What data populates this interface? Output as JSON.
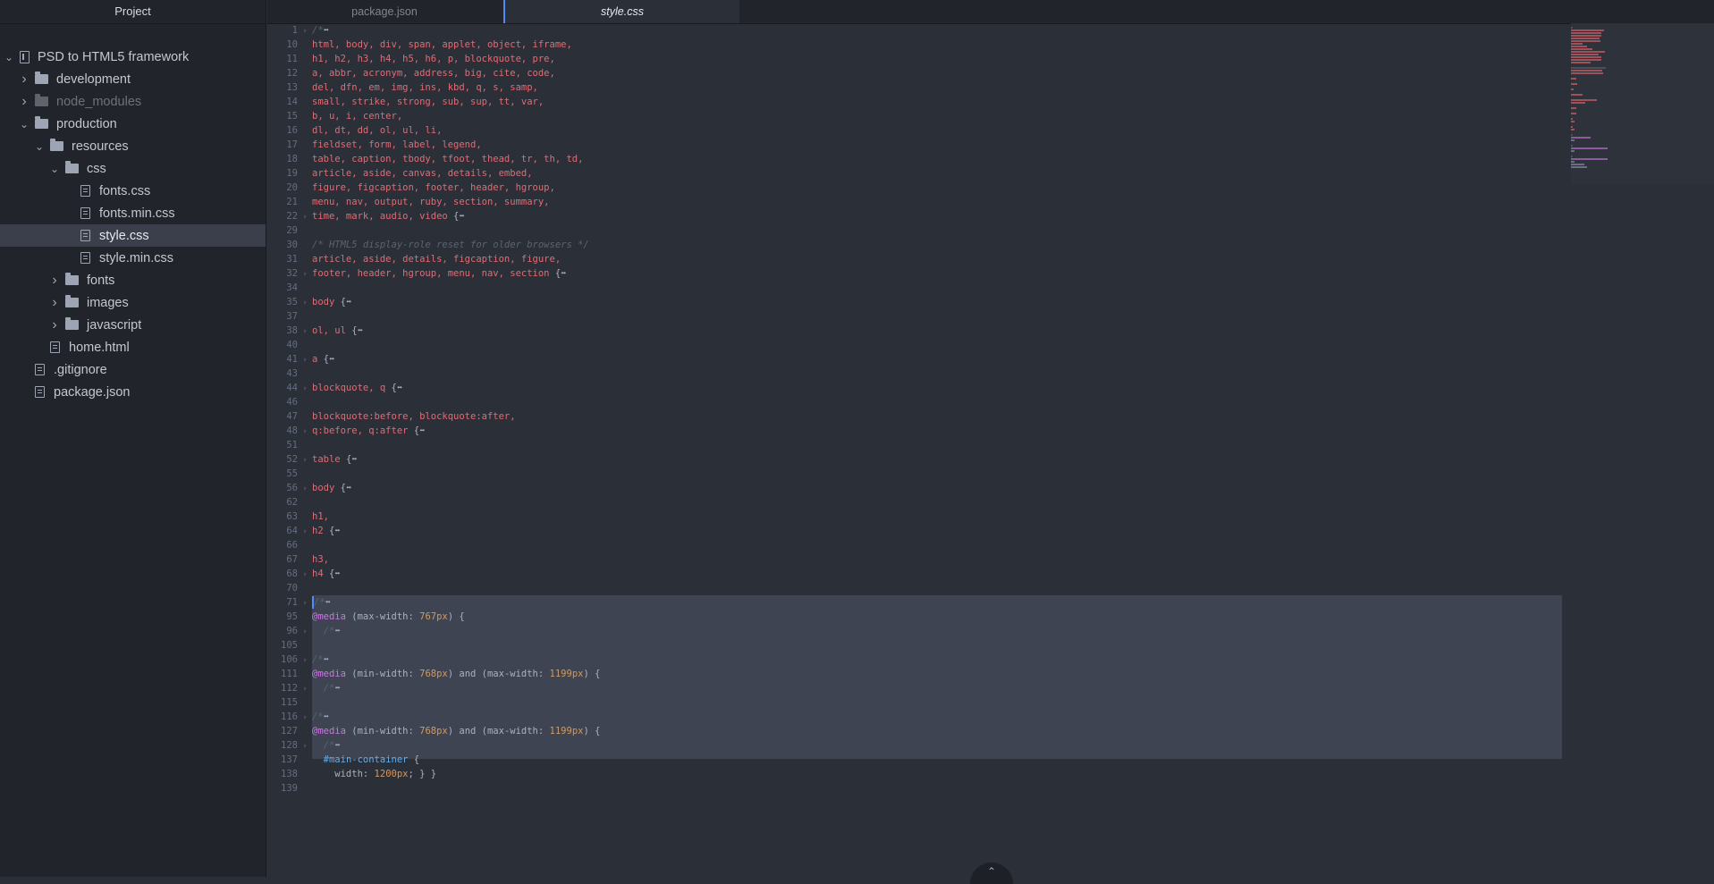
{
  "sidebar": {
    "title": "Project",
    "tree": [
      {
        "label": "PSD to HTML5 framework",
        "type": "repo",
        "depth": 0,
        "expanded": true
      },
      {
        "label": "development",
        "type": "folder",
        "depth": 1,
        "expanded": false
      },
      {
        "label": "node_modules",
        "type": "folder",
        "depth": 1,
        "expanded": false,
        "dim": true
      },
      {
        "label": "production",
        "type": "folder",
        "depth": 1,
        "expanded": true
      },
      {
        "label": "resources",
        "type": "folder",
        "depth": 2,
        "expanded": true
      },
      {
        "label": "css",
        "type": "folder",
        "depth": 3,
        "expanded": true
      },
      {
        "label": "fonts.css",
        "type": "file",
        "depth": 4
      },
      {
        "label": "fonts.min.css",
        "type": "file",
        "depth": 4
      },
      {
        "label": "style.css",
        "type": "file",
        "depth": 4,
        "selected": true
      },
      {
        "label": "style.min.css",
        "type": "file",
        "depth": 4
      },
      {
        "label": "fonts",
        "type": "folder",
        "depth": 3,
        "expanded": false
      },
      {
        "label": "images",
        "type": "folder",
        "depth": 3,
        "expanded": false
      },
      {
        "label": "javascript",
        "type": "folder",
        "depth": 3,
        "expanded": false
      },
      {
        "label": "home.html",
        "type": "file",
        "depth": 2
      },
      {
        "label": ".gitignore",
        "type": "file",
        "depth": 1
      },
      {
        "label": "package.json",
        "type": "file",
        "depth": 1
      }
    ]
  },
  "tabs": [
    {
      "label": "package.json",
      "active": false
    },
    {
      "label": "style.css",
      "active": true
    }
  ],
  "colors": {
    "selector": "#e06c75",
    "comment": "#5c6370",
    "keyword": "#c678dd",
    "number": "#d19a66",
    "id": "#61afef",
    "selection": "#3e4451",
    "accent": "#568af2"
  },
  "code": [
    {
      "n": "1",
      "fold": true,
      "parts": [
        [
          "cmt",
          "/*"
        ],
        [
          "badge",
          "⬌"
        ]
      ]
    },
    {
      "n": "10",
      "parts": [
        [
          "sel",
          "html, body, div, span, applet, object, iframe,"
        ]
      ]
    },
    {
      "n": "11",
      "parts": [
        [
          "sel",
          "h1, h2, h3, h4, h5, h6, p, blockquote, pre,"
        ]
      ]
    },
    {
      "n": "12",
      "parts": [
        [
          "sel",
          "a, abbr, acronym, address, big, cite, code,"
        ]
      ]
    },
    {
      "n": "13",
      "parts": [
        [
          "sel",
          "del, dfn, em, img, ins, kbd, q, s, samp,"
        ]
      ]
    },
    {
      "n": "14",
      "parts": [
        [
          "sel",
          "small, strike, strong, sub, sup, tt, var,"
        ]
      ]
    },
    {
      "n": "15",
      "parts": [
        [
          "sel",
          "b, u, i, center,"
        ]
      ]
    },
    {
      "n": "16",
      "parts": [
        [
          "sel",
          "dl, dt, dd, ol, ul, li,"
        ]
      ]
    },
    {
      "n": "17",
      "parts": [
        [
          "sel",
          "fieldset, form, label, legend,"
        ]
      ]
    },
    {
      "n": "18",
      "parts": [
        [
          "sel",
          "table, caption, tbody, tfoot, thead, tr, th, td,"
        ]
      ]
    },
    {
      "n": "19",
      "parts": [
        [
          "sel",
          "article, aside, canvas, details, embed,"
        ]
      ]
    },
    {
      "n": "20",
      "parts": [
        [
          "sel",
          "figure, figcaption, footer, header, hgroup,"
        ]
      ]
    },
    {
      "n": "21",
      "parts": [
        [
          "sel",
          "menu, nav, output, ruby, section, summary,"
        ]
      ]
    },
    {
      "n": "22",
      "fold": true,
      "parts": [
        [
          "sel",
          "time, mark, audio, video "
        ],
        [
          "txt",
          "{"
        ],
        [
          "badge",
          "⬌"
        ]
      ]
    },
    {
      "n": "29",
      "parts": []
    },
    {
      "n": "30",
      "parts": [
        [
          "cmt",
          "/* HTML5 display-role reset for older browsers */"
        ]
      ]
    },
    {
      "n": "31",
      "parts": [
        [
          "sel",
          "article, aside, details, figcaption, figure,"
        ]
      ]
    },
    {
      "n": "32",
      "fold": true,
      "parts": [
        [
          "sel",
          "footer, header, hgroup, menu, nav, section "
        ],
        [
          "txt",
          "{"
        ],
        [
          "badge",
          "⬌"
        ]
      ]
    },
    {
      "n": "34",
      "parts": []
    },
    {
      "n": "35",
      "fold": true,
      "parts": [
        [
          "sel",
          "body "
        ],
        [
          "txt",
          "{"
        ],
        [
          "badge",
          "⬌"
        ]
      ]
    },
    {
      "n": "37",
      "parts": []
    },
    {
      "n": "38",
      "fold": true,
      "parts": [
        [
          "sel",
          "ol, ul "
        ],
        [
          "txt",
          "{"
        ],
        [
          "badge",
          "⬌"
        ]
      ]
    },
    {
      "n": "40",
      "parts": []
    },
    {
      "n": "41",
      "fold": true,
      "parts": [
        [
          "sel",
          "a "
        ],
        [
          "txt",
          "{"
        ],
        [
          "badge",
          "⬌"
        ]
      ]
    },
    {
      "n": "43",
      "parts": []
    },
    {
      "n": "44",
      "fold": true,
      "parts": [
        [
          "sel",
          "blockquote, q "
        ],
        [
          "txt",
          "{"
        ],
        [
          "badge",
          "⬌"
        ]
      ]
    },
    {
      "n": "46",
      "parts": []
    },
    {
      "n": "47",
      "parts": [
        [
          "sel",
          "blockquote:before, blockquote:after,"
        ]
      ]
    },
    {
      "n": "48",
      "fold": true,
      "parts": [
        [
          "sel",
          "q:before, q:after "
        ],
        [
          "txt",
          "{"
        ],
        [
          "badge",
          "⬌"
        ]
      ]
    },
    {
      "n": "51",
      "parts": []
    },
    {
      "n": "52",
      "fold": true,
      "parts": [
        [
          "sel",
          "table "
        ],
        [
          "txt",
          "{"
        ],
        [
          "badge",
          "⬌"
        ]
      ]
    },
    {
      "n": "55",
      "parts": []
    },
    {
      "n": "56",
      "fold": true,
      "parts": [
        [
          "sel",
          "body "
        ],
        [
          "txt",
          "{"
        ],
        [
          "badge",
          "⬌"
        ]
      ]
    },
    {
      "n": "62",
      "parts": []
    },
    {
      "n": "63",
      "parts": [
        [
          "sel",
          "h1,"
        ]
      ]
    },
    {
      "n": "64",
      "fold": true,
      "parts": [
        [
          "sel",
          "h2 "
        ],
        [
          "txt",
          "{"
        ],
        [
          "badge",
          "⬌"
        ]
      ]
    },
    {
      "n": "66",
      "parts": []
    },
    {
      "n": "67",
      "parts": [
        [
          "sel",
          "h3,"
        ]
      ]
    },
    {
      "n": "68",
      "fold": true,
      "parts": [
        [
          "sel",
          "h4 "
        ],
        [
          "txt",
          "{"
        ],
        [
          "badge",
          "⬌"
        ]
      ]
    },
    {
      "n": "70",
      "parts": []
    },
    {
      "n": "71",
      "fold": true,
      "cursor": true,
      "parts": [
        [
          "cmt",
          "/*"
        ],
        [
          "badge",
          "⬌"
        ]
      ]
    },
    {
      "n": "95",
      "parts": [
        [
          "kw",
          "@media"
        ],
        [
          "txt",
          " (max-width: "
        ],
        [
          "num",
          "767px"
        ],
        [
          "txt",
          ") {"
        ]
      ]
    },
    {
      "n": "96",
      "fold": true,
      "parts": [
        [
          "txt",
          "  "
        ],
        [
          "cmt",
          "/*"
        ],
        [
          "badge",
          "⬌"
        ]
      ]
    },
    {
      "n": "105",
      "parts": []
    },
    {
      "n": "106",
      "fold": true,
      "parts": [
        [
          "cmt",
          "/*"
        ],
        [
          "badge",
          "⬌"
        ]
      ]
    },
    {
      "n": "111",
      "parts": [
        [
          "kw",
          "@media"
        ],
        [
          "txt",
          " (min-width: "
        ],
        [
          "num",
          "768px"
        ],
        [
          "txt",
          ") and (max-width: "
        ],
        [
          "num",
          "1199px"
        ],
        [
          "txt",
          ") {"
        ]
      ]
    },
    {
      "n": "112",
      "fold": true,
      "parts": [
        [
          "txt",
          "  "
        ],
        [
          "cmt",
          "/*"
        ],
        [
          "badge",
          "⬌"
        ]
      ]
    },
    {
      "n": "115",
      "parts": []
    },
    {
      "n": "116",
      "fold": true,
      "parts": [
        [
          "cmt",
          "/*"
        ],
        [
          "badge",
          "⬌"
        ]
      ]
    },
    {
      "n": "127",
      "parts": [
        [
          "kw",
          "@media"
        ],
        [
          "txt",
          " (min-width: "
        ],
        [
          "num",
          "768px"
        ],
        [
          "txt",
          ") and (max-width: "
        ],
        [
          "num",
          "1199px"
        ],
        [
          "txt",
          ") {"
        ]
      ]
    },
    {
      "n": "128",
      "fold": true,
      "parts": [
        [
          "txt",
          "  "
        ],
        [
          "cmt",
          "/*"
        ],
        [
          "badge",
          "⬌"
        ]
      ]
    },
    {
      "n": "137",
      "parts": [
        [
          "txt",
          "  "
        ],
        [
          "id",
          "#main-container"
        ],
        [
          "txt",
          " {"
        ]
      ]
    },
    {
      "n": "138",
      "parts": [
        [
          "txt",
          "    width: "
        ],
        [
          "num",
          "1200px"
        ],
        [
          "txt",
          "; } }"
        ]
      ]
    },
    {
      "n": "139",
      "parts": []
    }
  ]
}
